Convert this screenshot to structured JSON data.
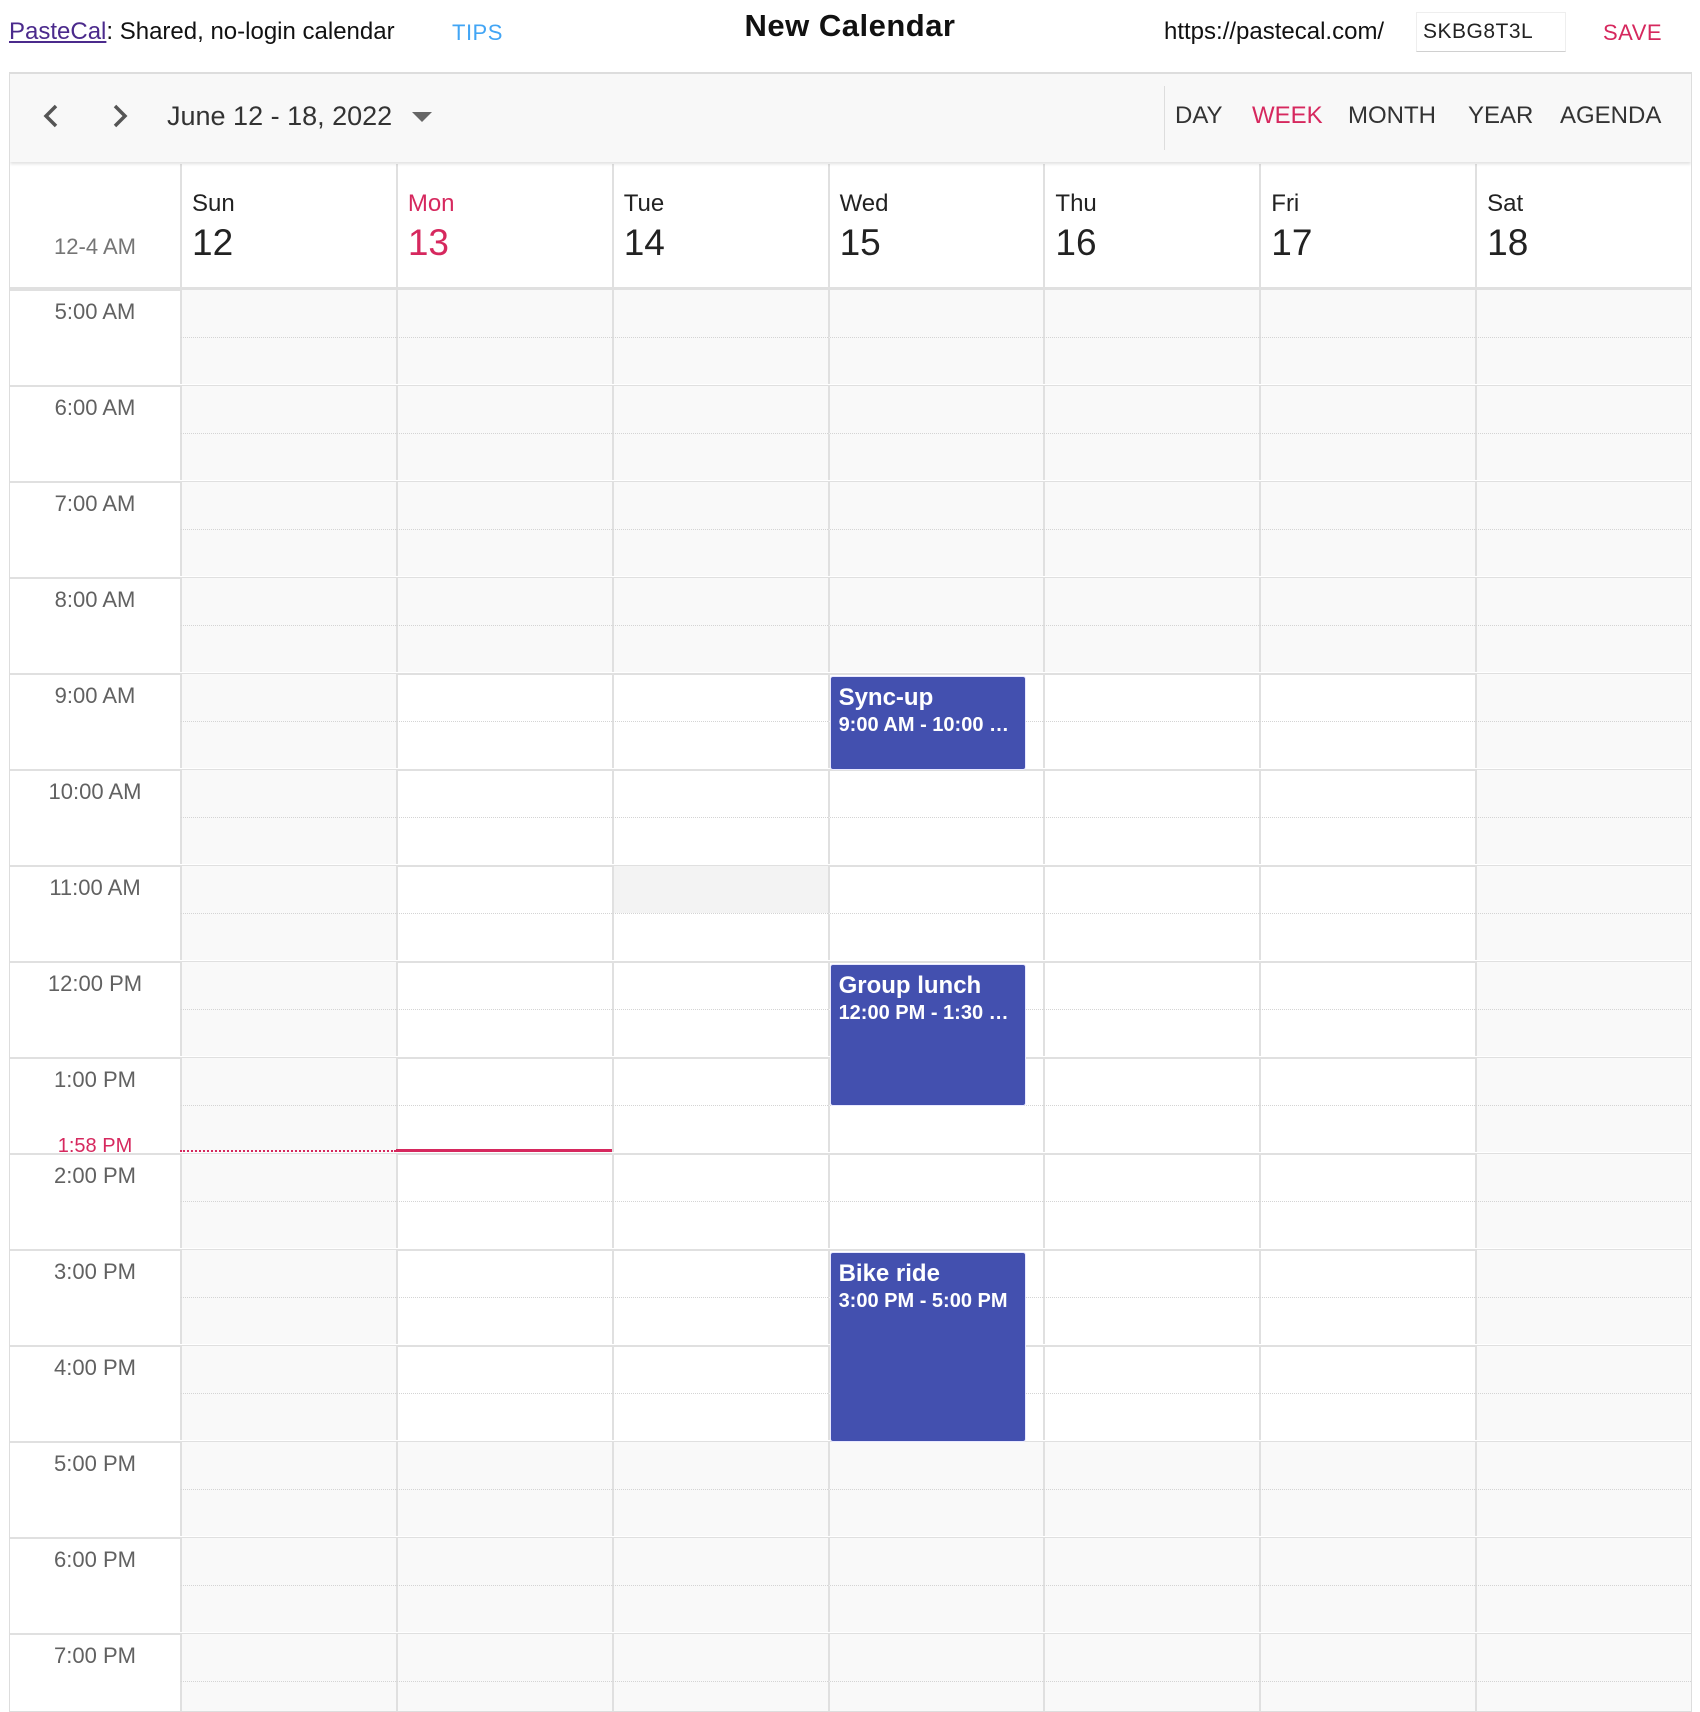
{
  "header": {
    "brand_link": "PasteCal",
    "brand_tagline": ": Shared, no-login calendar",
    "tips_label": "TIPS",
    "calendar_title": "New Calendar",
    "url_prefix": "https://pastecal.com/",
    "url_slug": "SKBG8T3L",
    "save_label": "SAVE"
  },
  "toolbar": {
    "prev_icon": "chevron-left-icon",
    "next_icon": "chevron-right-icon",
    "date_range": "June 12 - 18, 2022",
    "dropdown_icon": "caret-down-icon",
    "views": [
      {
        "label": "DAY",
        "active": false
      },
      {
        "label": "WEEK",
        "active": true
      },
      {
        "label": "MONTH",
        "active": false
      },
      {
        "label": "YEAR",
        "active": false
      },
      {
        "label": "AGENDA",
        "active": false
      }
    ]
  },
  "week": {
    "allday_label": "12-4 AM",
    "days": [
      {
        "name": "Sun",
        "num": "12",
        "today": false,
        "weekend": true
      },
      {
        "name": "Mon",
        "num": "13",
        "today": true,
        "weekend": false
      },
      {
        "name": "Tue",
        "num": "14",
        "today": false,
        "weekend": false
      },
      {
        "name": "Wed",
        "num": "15",
        "today": false,
        "weekend": false
      },
      {
        "name": "Thu",
        "num": "16",
        "today": false,
        "weekend": false
      },
      {
        "name": "Fri",
        "num": "17",
        "today": false,
        "weekend": false
      },
      {
        "name": "Sat",
        "num": "18",
        "today": false,
        "weekend": true
      }
    ],
    "hours": [
      "5:00 AM",
      "6:00 AM",
      "7:00 AM",
      "8:00 AM",
      "9:00 AM",
      "10:00 AM",
      "11:00 AM",
      "12:00 PM",
      "1:00 PM",
      "2:00 PM",
      "3:00 PM",
      "4:00 PM",
      "5:00 PM",
      "6:00 PM",
      "7:00 PM"
    ],
    "first_hour": 5,
    "work_start": 9,
    "work_end": 17,
    "highlighted_slot": {
      "day": 2,
      "hour": 11,
      "half": 0
    },
    "now": {
      "label": "1:58 PM",
      "hour": 13.9667,
      "day": 1
    }
  },
  "events": [
    {
      "title": "Sync-up",
      "time": "9:00 AM - 10:00 AM",
      "time_display": "9:00 AM - 10:00 …",
      "day": 3,
      "start": 9,
      "end": 10,
      "color": "#4350af"
    },
    {
      "title": "Group lunch",
      "time": "12:00 PM - 1:30 PM",
      "time_display": "12:00 PM - 1:30 …",
      "day": 3,
      "start": 12,
      "end": 13.5,
      "color": "#4350af"
    },
    {
      "title": "Bike ride",
      "time": "3:00 PM - 5:00 PM",
      "time_display": "3:00 PM - 5:00 PM",
      "day": 3,
      "start": 15,
      "end": 17,
      "color": "#4350af"
    }
  ]
}
